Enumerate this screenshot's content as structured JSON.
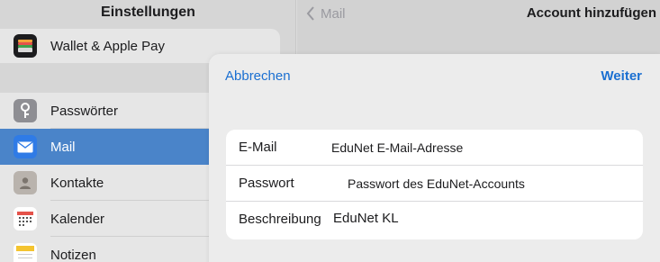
{
  "sidebar": {
    "title": "Einstellungen",
    "top_group": [
      {
        "label": "Wallet & Apple Pay",
        "icon": "wallet-icon"
      }
    ],
    "items": [
      {
        "label": "Passwörter",
        "icon": "key-icon",
        "selected": false
      },
      {
        "label": "Mail",
        "icon": "mail-icon",
        "selected": true
      },
      {
        "label": "Kontakte",
        "icon": "contacts-icon",
        "selected": false
      },
      {
        "label": "Kalender",
        "icon": "calendar-icon",
        "selected": false
      },
      {
        "label": "Notizen",
        "icon": "notes-icon",
        "selected": false
      }
    ],
    "selected_color": "#4a84c9"
  },
  "account_pane": {
    "back_label": "Mail",
    "title": "Account hinzufügen"
  },
  "sheet": {
    "cancel_label": "Abbrechen",
    "next_label": "Weiter",
    "accent_color": "#1a6fd1",
    "fields": [
      {
        "label": "E-Mail",
        "value": "EduNet E-Mail-Adresse"
      },
      {
        "label": "Passwort",
        "value": "Passwort des EduNet-Accounts"
      },
      {
        "label": "Beschreibung",
        "value": "EduNet KL"
      }
    ]
  }
}
